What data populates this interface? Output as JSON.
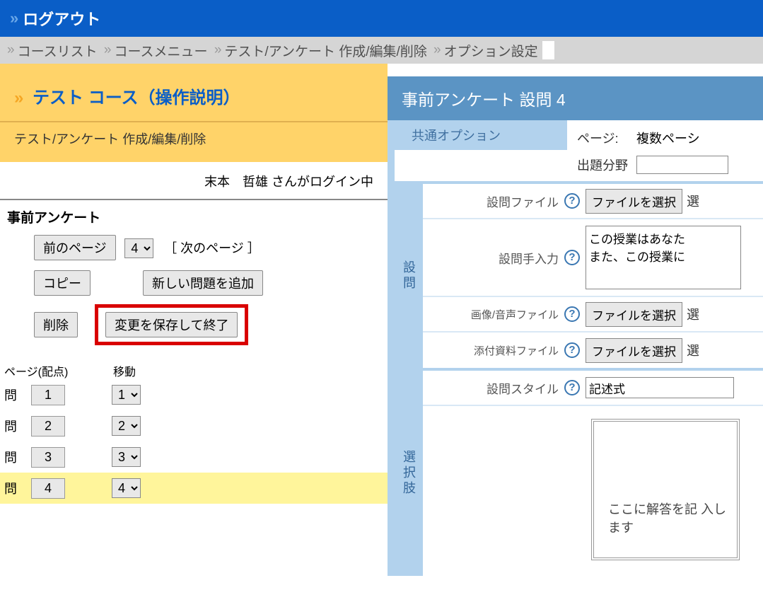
{
  "topbar": {
    "logout": "ログアウト"
  },
  "breadcrumb": {
    "items": [
      "コースリスト",
      "コースメニュー",
      "テスト/アンケート 作成/編集/削除",
      "オプション設定"
    ]
  },
  "left": {
    "course_title": "テスト コース（操作説明）",
    "subheader": "テスト/アンケート 作成/編集/削除",
    "login_status": "末本　哲雄 さんがログイン中",
    "section": "事前アンケート",
    "buttons": {
      "prev_page": "前のページ",
      "page_num": "4",
      "next_page": "［ 次のページ ］",
      "copy": "コピー",
      "add_new": "新しい問題を追加",
      "delete": "削除",
      "save_exit": "変更を保存して終了"
    },
    "cols": {
      "c1": "ページ(配点)",
      "c2": "移動"
    },
    "questions": [
      {
        "label": "問",
        "num": "1",
        "move": "1"
      },
      {
        "label": "問",
        "num": "2",
        "move": "2"
      },
      {
        "label": "問",
        "num": "3",
        "move": "3"
      },
      {
        "label": "問",
        "num": "4",
        "move": "4"
      }
    ],
    "selected_index": 3
  },
  "right": {
    "header": "事前アンケート  設問 4",
    "tab": "共通オプション",
    "page_label": "ページ:",
    "page_value": "複数ペーシ",
    "field_label": "出題分野",
    "field_value": "",
    "rows": {
      "q_file": "設問ファイル",
      "q_text": "設問手入力",
      "media_file": "画像/音声ファイル",
      "attach_file": "添付資料ファイル",
      "q_style": "設問スタイル"
    },
    "file_btn": "ファイルを選択",
    "file_trail": "選",
    "q_text_value": "この授業はあなた\nまた、この授業に",
    "style_value": "記述式",
    "side1": "設問",
    "side2": "選択肢",
    "answer_placeholder": "ここに解答を記\n入します"
  }
}
